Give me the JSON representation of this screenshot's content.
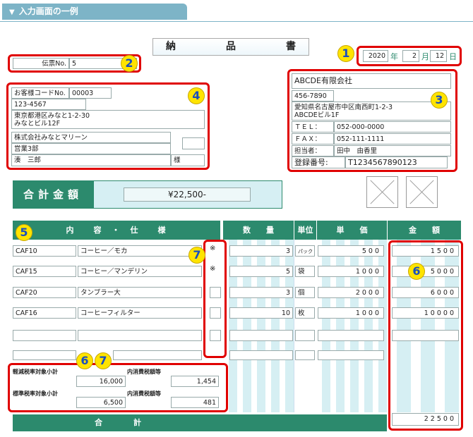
{
  "header_tab": {
    "arrow": "▼",
    "label": "入力画面の一例"
  },
  "title": {
    "chars": [
      "納",
      "品",
      "書"
    ]
  },
  "date": {
    "year": "2020",
    "year_unit": "年",
    "month": "2",
    "month_unit": "月",
    "day": "12",
    "day_unit": "日"
  },
  "slip": {
    "label": "伝票No.",
    "value": "5"
  },
  "customer": {
    "code_label": "お客様コードNo.",
    "code": "00003",
    "zip": "123-4567",
    "addr1": "東京都港区みなと1-2-30",
    "addr2": "みなとビル12F",
    "company": "株式会社みなとマリーン",
    "dept": "営業3部",
    "person": "湊　三郎",
    "honorific": "様"
  },
  "sender": {
    "company": "ABCDE有限会社",
    "zip": "456-7890",
    "addr1": "愛知県名古屋市中区南西町1-2-3",
    "addr2": "ABCDEビル1F",
    "tel_label": "ＴＥＬ：",
    "tel": "052-000-0000",
    "fax_label": "ＦＡＸ：",
    "fax": "052-111-1111",
    "staff_label": "担当者：",
    "staff": "田中　由香里",
    "reg_label": "登録番号:",
    "reg": "T1234567890123"
  },
  "total": {
    "label": "合計金額",
    "value": "¥22,500-"
  },
  "table_headers": {
    "item": "内　　容　・　仕　　様",
    "qty": "数　　量",
    "unit": "単位",
    "price": "単　　価",
    "amount": "金　　額"
  },
  "rows": [
    {
      "code": "CAF10",
      "name": "コーヒー／モカ",
      "mark": "※",
      "qty": "3",
      "unit": "パック",
      "price": "500",
      "amount": "1500"
    },
    {
      "code": "CAF15",
      "name": "コーヒー／マンデリン",
      "mark": "※",
      "qty": "5",
      "unit": "袋",
      "price": "1000",
      "amount": "5000"
    },
    {
      "code": "CAF20",
      "name": "タンブラー大",
      "mark": "",
      "qty": "3",
      "unit": "個",
      "price": "2000",
      "amount": "6000"
    },
    {
      "code": "CAF16",
      "name": "コーヒーフィルター",
      "mark": "",
      "qty": "10",
      "unit": "枚",
      "price": "1000",
      "amount": "10000"
    }
  ],
  "tax": {
    "reduced_label": "軽減税率対象小計",
    "reduced_value": "16,000",
    "reduced_tax_label": "内消費税額等",
    "reduced_tax_value": "1,454",
    "standard_label": "標準税率対象小計",
    "standard_value": "6,500",
    "standard_tax_label": "内消費税額等",
    "standard_tax_value": "481"
  },
  "grand_total": {
    "label": "合　　　　計",
    "value": "22500"
  },
  "markers": {
    "m1": "1",
    "m2": "2",
    "m3": "3",
    "m4": "4",
    "m5": "5",
    "m6": "6",
    "m7": "7"
  },
  "colors": {
    "accent": "#2c8a6d",
    "stripe": "#d6eff3",
    "tab": "#7db4c7",
    "highlight": "#e00000",
    "marker": "#ffe400"
  }
}
